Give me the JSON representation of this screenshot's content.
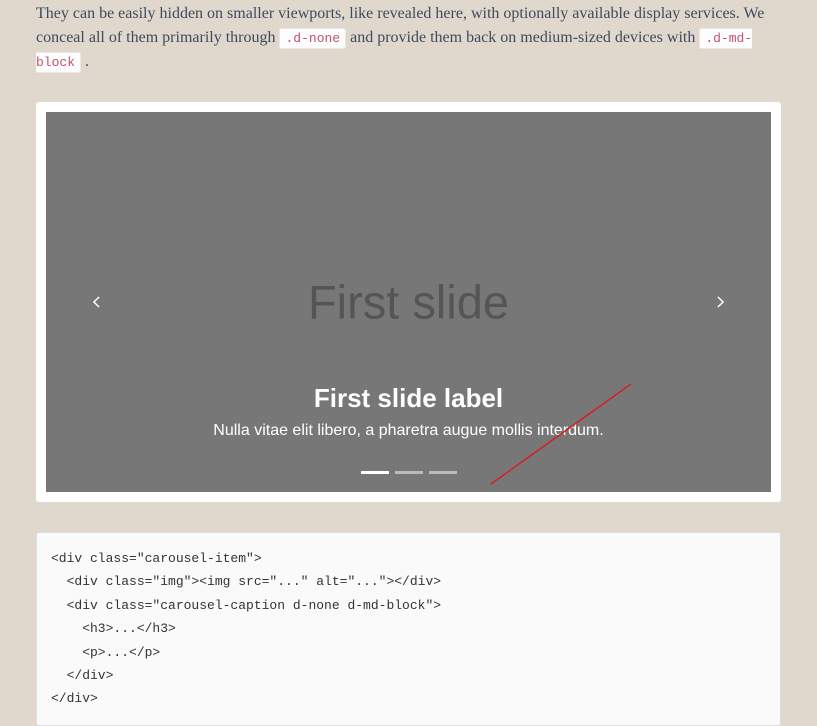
{
  "intro": {
    "part1": "They can be easily hidden on smaller viewports, like revealed here, with optionally available display services. We conceal all of them primarily through ",
    "code1": ".d-none",
    "part2": " and provide them back on medium-sized devices with ",
    "code2": ".d-md-block",
    "part3": "."
  },
  "carousel": {
    "slide_placeholder": "First slide",
    "caption_heading": "First slide label",
    "caption_text": "Nulla vitae elit libero, a pharetra augue mollis interdum."
  },
  "code_sample": "<div class=\"carousel-item\">\n  <div class=\"img\"><img src=\"...\" alt=\"...\"></div>\n  <div class=\"carousel-caption d-none d-md-block\">\n    <h3>...</h3>\n    <p>...</p>\n  </div>\n</div>"
}
